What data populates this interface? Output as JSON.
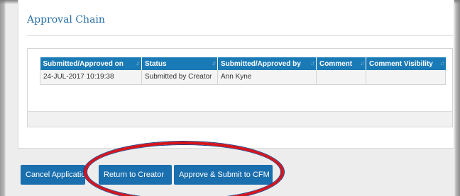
{
  "section": {
    "title": "Approval Chain"
  },
  "table": {
    "columns": [
      "Submitted/Approved on",
      "Status",
      "Submitted/Approved by",
      "Comment",
      "Comment Visibility"
    ],
    "rows": [
      {
        "submitted_on": "24-JUL-2017 10:19:38",
        "status": "Submitted by Creator",
        "submitted_by": "Ann Kyne",
        "comment": "",
        "comment_visibility": ""
      }
    ]
  },
  "actions": {
    "cancel": "Cancel Application",
    "return": "Return to Creator",
    "approve": "Approve & Submit to CFM"
  },
  "annotation": {
    "color": "#d8141a"
  }
}
